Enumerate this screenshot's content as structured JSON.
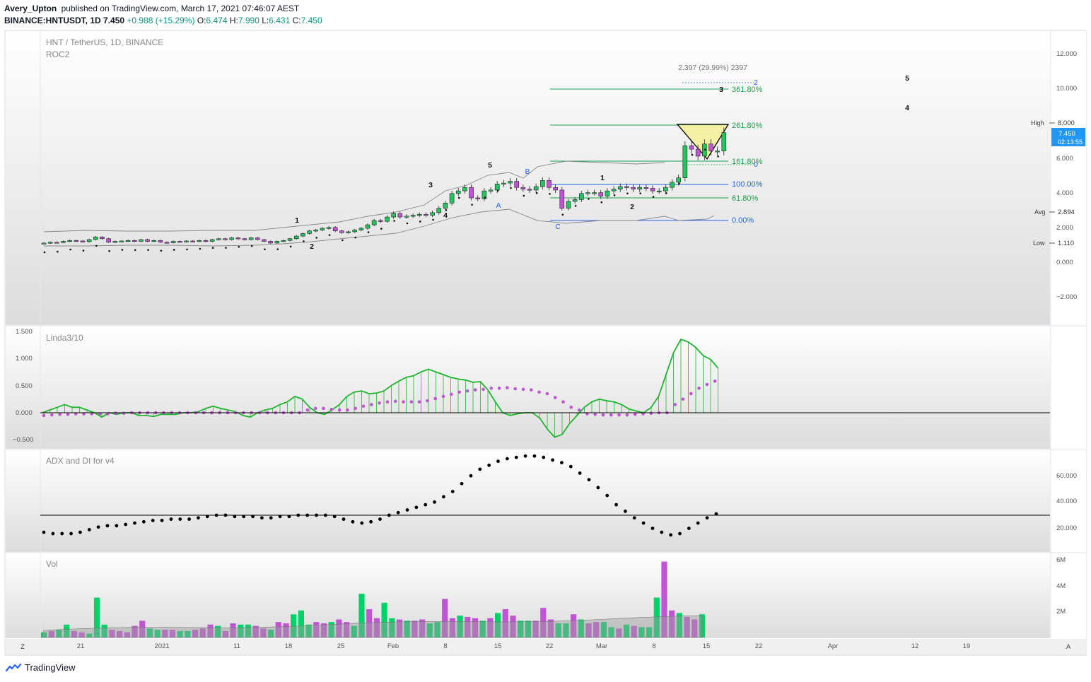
{
  "header": {
    "author": "Avery_Upton",
    "published": "published on TradingView.com, March 17, 2021 07:46:07 AEST",
    "symbol": "BINANCE:HNTUSDT, 1D",
    "price": "7.450",
    "change": "+0.988 (+15.29%)",
    "o_label": "O:",
    "o": "6.474",
    "h_label": "H:",
    "h": "7.990",
    "l_label": "L:",
    "l": "6.431",
    "c_label": "C:",
    "c": "7.450"
  },
  "colors": {
    "up": "#22c55e",
    "down": "#c154d4",
    "pane_bg": "#e6e6e6",
    "fib_green": "#16a34a",
    "fib_blue": "#2563eb",
    "price_tag": "#2196f3",
    "linda_line": "#1fb52e",
    "linda_dots": "#c154d4",
    "vol_up": "#00d26a",
    "vol_down": "#c154d4"
  },
  "main_pane": {
    "title": "HNT / TetherUS, 1D, BINANCE",
    "indicator": "ROC2",
    "y_ticks": [
      "12.000",
      "10.000",
      "8.000",
      "6.000",
      "4.000",
      "2.000",
      "0.000",
      "−2.000"
    ],
    "high_label": "High",
    "high_value": "8.000",
    "last_price": "7.450",
    "countdown": "02:13:55",
    "avg_label": "Avg",
    "avg_value": "2.894",
    "low_label": "Low",
    "low_value": "1.110",
    "measure_label": "2.397 (29.99%) 2397",
    "fib_levels": [
      "361.80%",
      "261.80%",
      "161.80%",
      "100.00%",
      "61.80%",
      "0.00%"
    ],
    "wave_labels": [
      "1",
      "2",
      "3",
      "4",
      "5",
      "A",
      "B",
      "C",
      "1",
      "2",
      "3",
      "4",
      "5",
      "2",
      "0"
    ]
  },
  "linda_pane": {
    "title": "Linda3/10",
    "y_ticks": [
      "1.500",
      "1.000",
      "0.500",
      "0.000",
      "−0.500"
    ]
  },
  "adx_pane": {
    "title": "ADX and DI for v4",
    "y_ticks": [
      "60.000",
      "40.000",
      "20.000"
    ]
  },
  "vol_pane": {
    "title": "Vol",
    "y_ticks": [
      "6M",
      "4M",
      "2M"
    ]
  },
  "time_axis": {
    "left_button": "Z",
    "right_button": "A",
    "labels": [
      "21",
      "2021",
      "11",
      "18",
      "25",
      "Feb",
      "8",
      "15",
      "22",
      "Mar",
      "8",
      "15",
      "22",
      "Apr",
      "12",
      "19"
    ]
  },
  "footer": {
    "brand": "TradingView"
  },
  "chart_data": [
    {
      "type": "candlestick",
      "title": "HNT / TetherUS, 1D, BINANCE",
      "ylim": [
        -2.5,
        13
      ],
      "close": [
        1.1,
        1.15,
        1.13,
        1.2,
        1.25,
        1.22,
        1.18,
        1.3,
        1.45,
        1.35,
        1.15,
        1.2,
        1.22,
        1.25,
        1.2,
        1.3,
        1.2,
        1.25,
        1.15,
        1.12,
        1.2,
        1.18,
        1.22,
        1.2,
        1.25,
        1.2,
        1.3,
        1.35,
        1.3,
        1.4,
        1.35,
        1.3,
        1.4,
        1.3,
        1.2,
        1.1,
        1.2,
        1.25,
        1.35,
        1.5,
        1.65,
        1.8,
        1.85,
        1.95,
        2.0,
        1.8,
        1.7,
        1.75,
        1.85,
        1.95,
        2.15,
        2.4,
        2.35,
        2.6,
        2.8,
        2.6,
        2.65,
        2.7,
        2.75,
        2.7,
        2.85,
        3.1,
        3.4,
        3.95,
        4.1,
        4.3,
        3.7,
        3.65,
        4.1,
        4.15,
        4.5,
        4.55,
        4.65,
        4.3,
        4.2,
        4.15,
        4.35,
        4.7,
        4.3,
        4.15,
        3.1,
        3.5,
        3.6,
        3.95,
        4.0,
        4.0,
        3.8,
        4.1,
        4.2,
        4.35,
        4.3,
        4.2,
        4.3,
        4.25,
        4.1,
        4.1,
        4.3,
        4.6,
        4.85,
        6.7,
        6.5,
        6.1,
        6.8,
        6.4,
        6.4,
        7.45
      ]
    },
    {
      "type": "line",
      "title": "Linda3/10",
      "ylim": [
        -0.5,
        1.5
      ],
      "values": [
        0.0,
        0.05,
        0.1,
        0.15,
        0.1,
        0.1,
        0.05,
        0.0,
        -0.08,
        0.0,
        -0.03,
        0.0,
        0.0,
        -0.05,
        -0.05,
        -0.07,
        -0.03,
        -0.03,
        -0.03,
        0.0,
        0.0,
        0.02,
        0.08,
        0.12,
        0.08,
        0.05,
        0.02,
        -0.05,
        -0.08,
        0.0,
        0.05,
        0.08,
        0.15,
        0.2,
        0.3,
        0.25,
        0.1,
        0.0,
        -0.03,
        0.05,
        0.15,
        0.3,
        0.38,
        0.4,
        0.35,
        0.36,
        0.4,
        0.5,
        0.58,
        0.65,
        0.68,
        0.75,
        0.8,
        0.75,
        0.7,
        0.65,
        0.62,
        0.6,
        0.56,
        0.57,
        0.42,
        0.2,
        0.0,
        -0.05,
        -0.02,
        0.0,
        0.0,
        -0.1,
        -0.3,
        -0.45,
        -0.4,
        -0.2,
        -0.05,
        0.1,
        0.2,
        0.25,
        0.22,
        0.2,
        0.15,
        0.07,
        0.03,
        0.0,
        0.1,
        0.3,
        0.7,
        1.1,
        1.35,
        1.3,
        1.2,
        1.05,
        0.98,
        0.82
      ],
      "signal": [
        -0.05,
        -0.04,
        -0.03,
        -0.03,
        -0.02,
        -0.02,
        -0.02,
        -0.02,
        -0.02,
        -0.01,
        -0.01,
        0.0,
        0.0,
        0.0,
        0.0,
        0.0,
        0.0,
        0.0,
        0.0,
        0.0,
        0.0,
        0.0,
        0.0,
        0.0,
        0.0,
        0.0,
        0.0,
        0.0,
        0.0,
        0.0,
        0.0,
        0.0,
        0.0,
        0.05,
        0.08,
        0.08,
        0.06,
        0.05,
        0.05,
        0.08,
        0.12,
        0.15,
        0.18,
        0.2,
        0.21,
        0.2,
        0.2,
        0.2,
        0.22,
        0.26,
        0.3,
        0.34,
        0.38,
        0.4,
        0.42,
        0.43,
        0.45,
        0.45,
        0.46,
        0.44,
        0.43,
        0.42,
        0.38,
        0.35,
        0.28,
        0.2,
        0.1,
        0.05,
        -0.02,
        -0.03,
        -0.04,
        -0.04,
        -0.04,
        -0.04,
        -0.03,
        -0.02,
        -0.01,
        0.0,
        0.0,
        0.15,
        0.25,
        0.35,
        0.45,
        0.52,
        0.58
      ]
    },
    {
      "type": "scatter",
      "title": "ADX and DI for v4",
      "ylim": [
        10,
        70
      ],
      "reference_line": 30,
      "values": [
        17,
        16,
        16,
        16,
        17,
        19,
        21,
        22,
        22,
        23,
        24,
        25,
        26,
        26,
        27,
        27,
        27,
        28,
        29,
        30,
        30,
        29,
        29,
        29,
        28,
        28,
        29,
        29,
        30,
        30,
        30,
        30,
        29,
        27,
        25,
        24,
        25,
        27,
        30,
        32,
        34,
        36,
        38,
        40,
        44,
        48,
        54,
        60,
        65,
        68,
        71,
        73,
        74,
        75,
        75,
        74,
        72,
        70,
        67,
        62,
        57,
        51,
        45,
        38,
        33,
        28,
        24,
        20,
        17,
        15,
        16,
        20,
        24,
        28,
        31
      ]
    },
    {
      "type": "bar",
      "title": "Vol",
      "ylim": [
        0,
        6500000
      ],
      "values": [
        0.4,
        0.5,
        0.6,
        1.0,
        0.5,
        0.4,
        0.3,
        3.1,
        1.0,
        0.6,
        0.5,
        0.4,
        0.9,
        1.3,
        0.7,
        0.6,
        0.6,
        0.6,
        0.5,
        0.5,
        0.6,
        0.7,
        1.0,
        0.9,
        0.5,
        1.1,
        1.0,
        1.0,
        0.9,
        0.7,
        0.6,
        1.2,
        1.1,
        1.8,
        2.1,
        1.0,
        1.2,
        1.1,
        1.2,
        1.4,
        1.2,
        0.9,
        3.4,
        2.2,
        1.5,
        2.7,
        1.5,
        1.4,
        1.3,
        1.3,
        1.4,
        1.1,
        1.2,
        3.0,
        1.5,
        1.7,
        1.6,
        1.5,
        1.3,
        1.5,
        1.9,
        2.2,
        1.7,
        1.3,
        1.3,
        1.3,
        2.3,
        1.4,
        1.1,
        1.1,
        1.8,
        1.4,
        1.1,
        1.2,
        1.2,
        0.8,
        0.7,
        1.0,
        0.9,
        0.8,
        0.8,
        3.1,
        5.9,
        2.1,
        1.9,
        1.6,
        1.4,
        1.8
      ],
      "down": [
        0,
        1,
        0,
        0,
        1,
        1,
        0,
        0,
        0,
        1,
        1,
        1,
        1,
        1,
        0,
        0,
        1,
        1,
        0,
        0,
        1,
        1,
        1,
        0,
        1,
        1,
        0,
        0,
        1,
        1,
        0,
        1,
        1,
        0,
        0,
        0,
        1,
        1,
        0,
        1,
        1,
        0,
        0,
        1,
        1,
        0,
        0,
        1,
        0,
        1,
        1,
        0,
        0,
        1,
        1,
        0,
        1,
        1,
        0,
        1,
        0,
        1,
        1,
        0,
        0,
        1,
        1,
        1,
        0,
        0,
        1,
        0,
        1,
        1,
        0,
        0,
        1,
        0,
        1,
        0,
        0,
        0,
        1,
        1,
        0,
        1,
        1,
        0
      ]
    }
  ]
}
